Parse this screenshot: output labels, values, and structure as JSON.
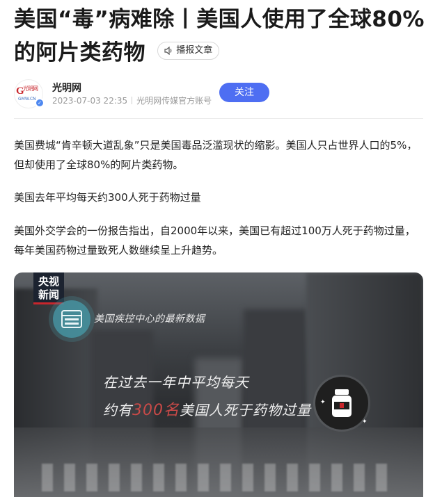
{
  "article": {
    "title": "美国“毒”病难除丨美国人使用了全球80%的阿片类药物",
    "play_label": "播报文章"
  },
  "author": {
    "name": "光明网",
    "date": "2023-07-03 22:35",
    "account": "光明网传媒官方账号",
    "follow_label": "关注",
    "avatar_brand": "光明网",
    "avatar_sub": "GMW.CN"
  },
  "body": {
    "p1": "美国费城“肯辛顿大道乱象”只是美国毒品泛滥现状的缩影。美国人只占世界人口的5%，但却使用了全球80%的阿片类药物。",
    "p2": "美国去年平均每天约300人死于药物过量",
    "p3": "美国外交学会的一份报告指出，自2000年以来，美国已有超过100万人死于药物过量，每年美国药物过量致死人数继续呈上升趋势。"
  },
  "video": {
    "logo_line1": "央视",
    "logo_line2": "新闻",
    "source_label": "美国疾控中心的最新数据",
    "caption_line1": "在过去一年中平均每天",
    "caption_pre": "约有",
    "caption_highlight": "300名",
    "caption_post": "美国人死于药物过量",
    "highlight_color": "#c94a48"
  },
  "colors": {
    "accent": "#4e6ef2",
    "brand_red": "#c8262c"
  }
}
